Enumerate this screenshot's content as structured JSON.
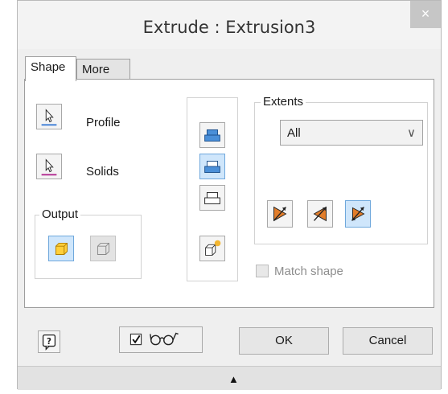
{
  "window": {
    "title": "Extrude : Extrusion3",
    "close_glyph": "×"
  },
  "tabs": [
    {
      "label": "Shape",
      "active": true
    },
    {
      "label": "More",
      "active": false
    }
  ],
  "shape": {
    "profile_label": "Profile",
    "solids_label": "Solids",
    "output_label": "Output",
    "extents_label": "Extents",
    "extents_value": "All",
    "extents_arrow": "∨",
    "match_shape_label": "Match shape",
    "match_shape_checked": false
  },
  "footer": {
    "help_glyph": "?",
    "preview_checked": true,
    "ok_label": "OK",
    "cancel_label": "Cancel",
    "expand_glyph": "▲"
  },
  "colors": {
    "accent_blue": "#4a8fd8",
    "selection_bg": "#cfe6fb",
    "profile_line": "#3a7bd5",
    "solids_line": "#b0288f",
    "solid_yellow": "#ffcf3a",
    "arrow_orange": "#e27d2a"
  }
}
